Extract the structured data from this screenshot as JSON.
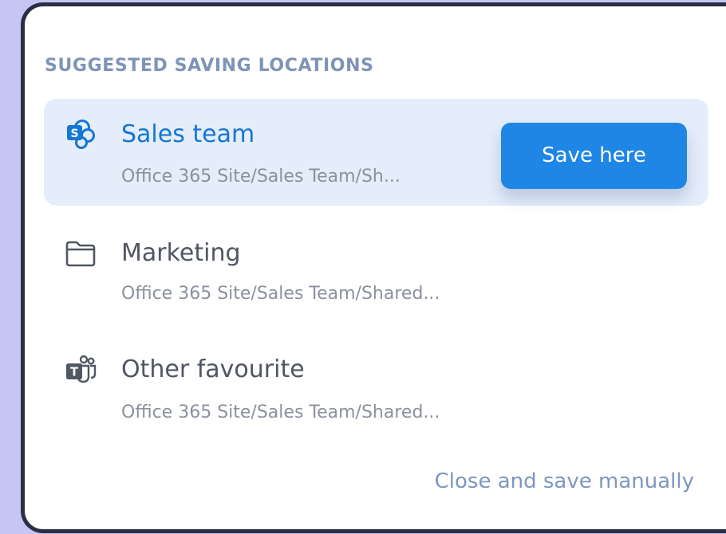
{
  "section_title": "SUGGESTED SAVING LOCATIONS",
  "locations": [
    {
      "name": "Sales team",
      "path": "Office 365 Site/Sales Team/Sh...",
      "icon": "sharepoint-icon",
      "selected": true,
      "action_label": "Save here"
    },
    {
      "name": "Marketing",
      "path": "Office 365 Site/Sales Team/Shared...",
      "icon": "folder-icon",
      "selected": false
    },
    {
      "name": "Other favourite",
      "path": "Office 365 Site/Sales Team/Shared...",
      "icon": "teams-icon",
      "selected": false
    }
  ],
  "close_link": "Close and save manually",
  "colors": {
    "background": "#c5c6f3",
    "panel_border": "#2b2f44",
    "section_title": "#7e93b6",
    "selected_row": "#e4edf9",
    "accent": "#1f86e6",
    "selected_text": "#1477d4",
    "link": "#7d97bf"
  }
}
